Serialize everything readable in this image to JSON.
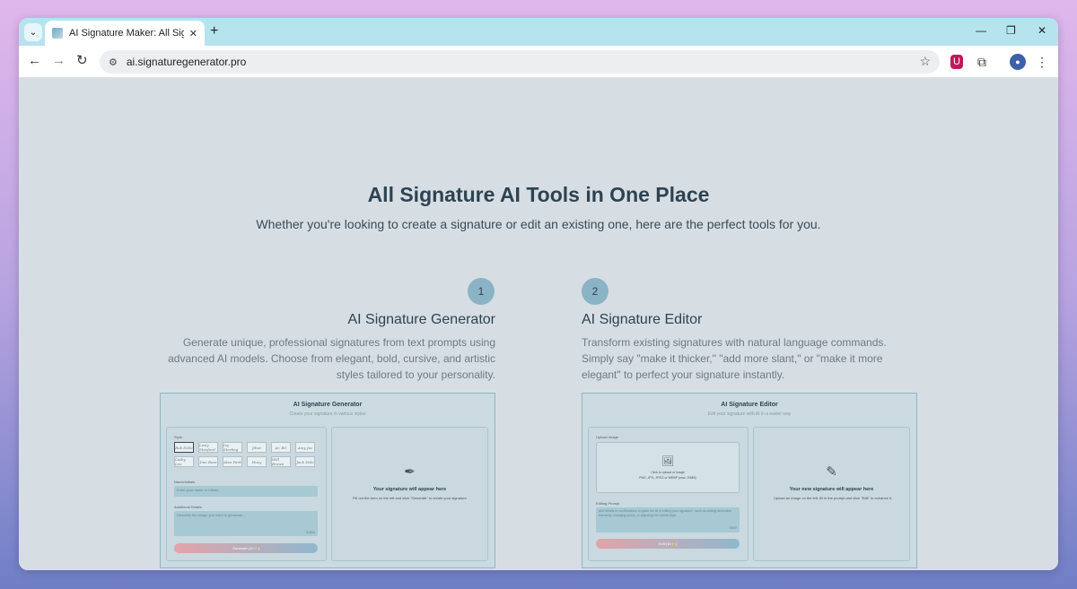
{
  "browser": {
    "tab_title": "AI Signature Maker: All Signatu",
    "url": "ai.signaturegenerator.pro",
    "new_tab": "+",
    "close": "✕"
  },
  "hero": {
    "title": "All Signature AI Tools in One Place",
    "subtitle": "Whether you're looking to create a signature or edit an existing one, here are the perfect tools for you."
  },
  "cards": [
    {
      "number": "1",
      "title": "AI Signature Generator",
      "desc_lines": [
        "Generate unique, professional signatures from text prompts using",
        "advanced AI models. Choose from elegant, bold, cursive, and artistic",
        "styles tailored to your personality."
      ],
      "shot": {
        "title": "AI Signature Generator",
        "subtitle": "Create your signature in various styles",
        "style_label": "Style",
        "name_label": "Name/Initials",
        "name_placeholder": "Enter your name or initials",
        "details_label": "Additional Details",
        "details_placeholder": "Describe the image you want to generate...",
        "counter": "0/500",
        "button": "Generate (10⚡)",
        "result_title": "Your signature will appear here",
        "result_text": "Fill out the form on the left and click \"Generate\" to create your signature."
      }
    },
    {
      "number": "2",
      "title": "AI Signature Editor",
      "desc_lines": [
        "Transform existing signatures with natural language commands.",
        "Simply say \"make it thicker,\" \"add more slant,\" or \"make it more",
        "elegant\" to perfect your signature instantly."
      ],
      "shot": {
        "title": "AI Signature Editor",
        "subtitle": "Edit your signature with AI in a easier way",
        "upload_label": "Upload Image",
        "upload_text": "Click to upload or image",
        "upload_hint": "PNG, JPG, JPEG or WEBP (max. 20MB)",
        "prompt_label": "Editing Prompt",
        "prompt_placeholder": "Add details or modifications to guide the AI in editing your signature - such as adding decorative elements, changing colors, or adjusting the overall style.",
        "counter": "0/800",
        "button": "Edit (10⚡)",
        "result_title": "Your new signature will appear here",
        "result_text": "Upload an image on the left, fill in the prompt and click \"Edit\" to enhance it."
      }
    }
  ],
  "style_samples": [
    "Bob Dolle",
    "Lesly Stanford",
    "Ivy Sterling",
    "Jdwe",
    "Ar. RG",
    "Amy Jaz",
    "Cathy Leo",
    "Dan Ross",
    "Alan Park",
    "Huey",
    "Will Brown",
    "Jack Dale"
  ]
}
